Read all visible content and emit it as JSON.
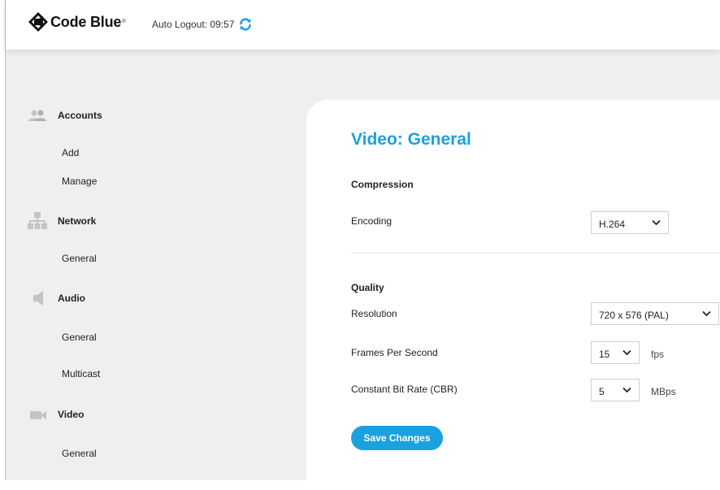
{
  "header": {
    "brand": "Code Blue",
    "brand_tm": "®",
    "auto_logout_label": "Auto Logout: 09:57",
    "accent_color": "#1aa1e0"
  },
  "sidebar": {
    "groups": [
      {
        "label": "Accounts",
        "icon": "users-icon",
        "items": [
          "Add",
          "Manage"
        ]
      },
      {
        "label": "Network",
        "icon": "network-icon",
        "items": [
          "General"
        ]
      },
      {
        "label": "Audio",
        "icon": "speaker-icon",
        "items": [
          "General",
          "Multicast"
        ]
      },
      {
        "label": "Video",
        "icon": "video-camera-icon",
        "items": [
          "General"
        ]
      }
    ]
  },
  "main": {
    "title": "Video: General",
    "compression": {
      "title": "Compression",
      "encoding_label": "Encoding",
      "encoding_value": "H.264"
    },
    "quality": {
      "title": "Quality",
      "resolution_label": "Resolution",
      "resolution_value": "720 x 576 (PAL)",
      "fps_label": "Frames Per Second",
      "fps_value": "15",
      "fps_unit": "fps",
      "cbr_label": "Constant Bit Rate (CBR)",
      "cbr_value": "5",
      "cbr_unit": "MBps"
    },
    "save_label": "Save Changes"
  }
}
